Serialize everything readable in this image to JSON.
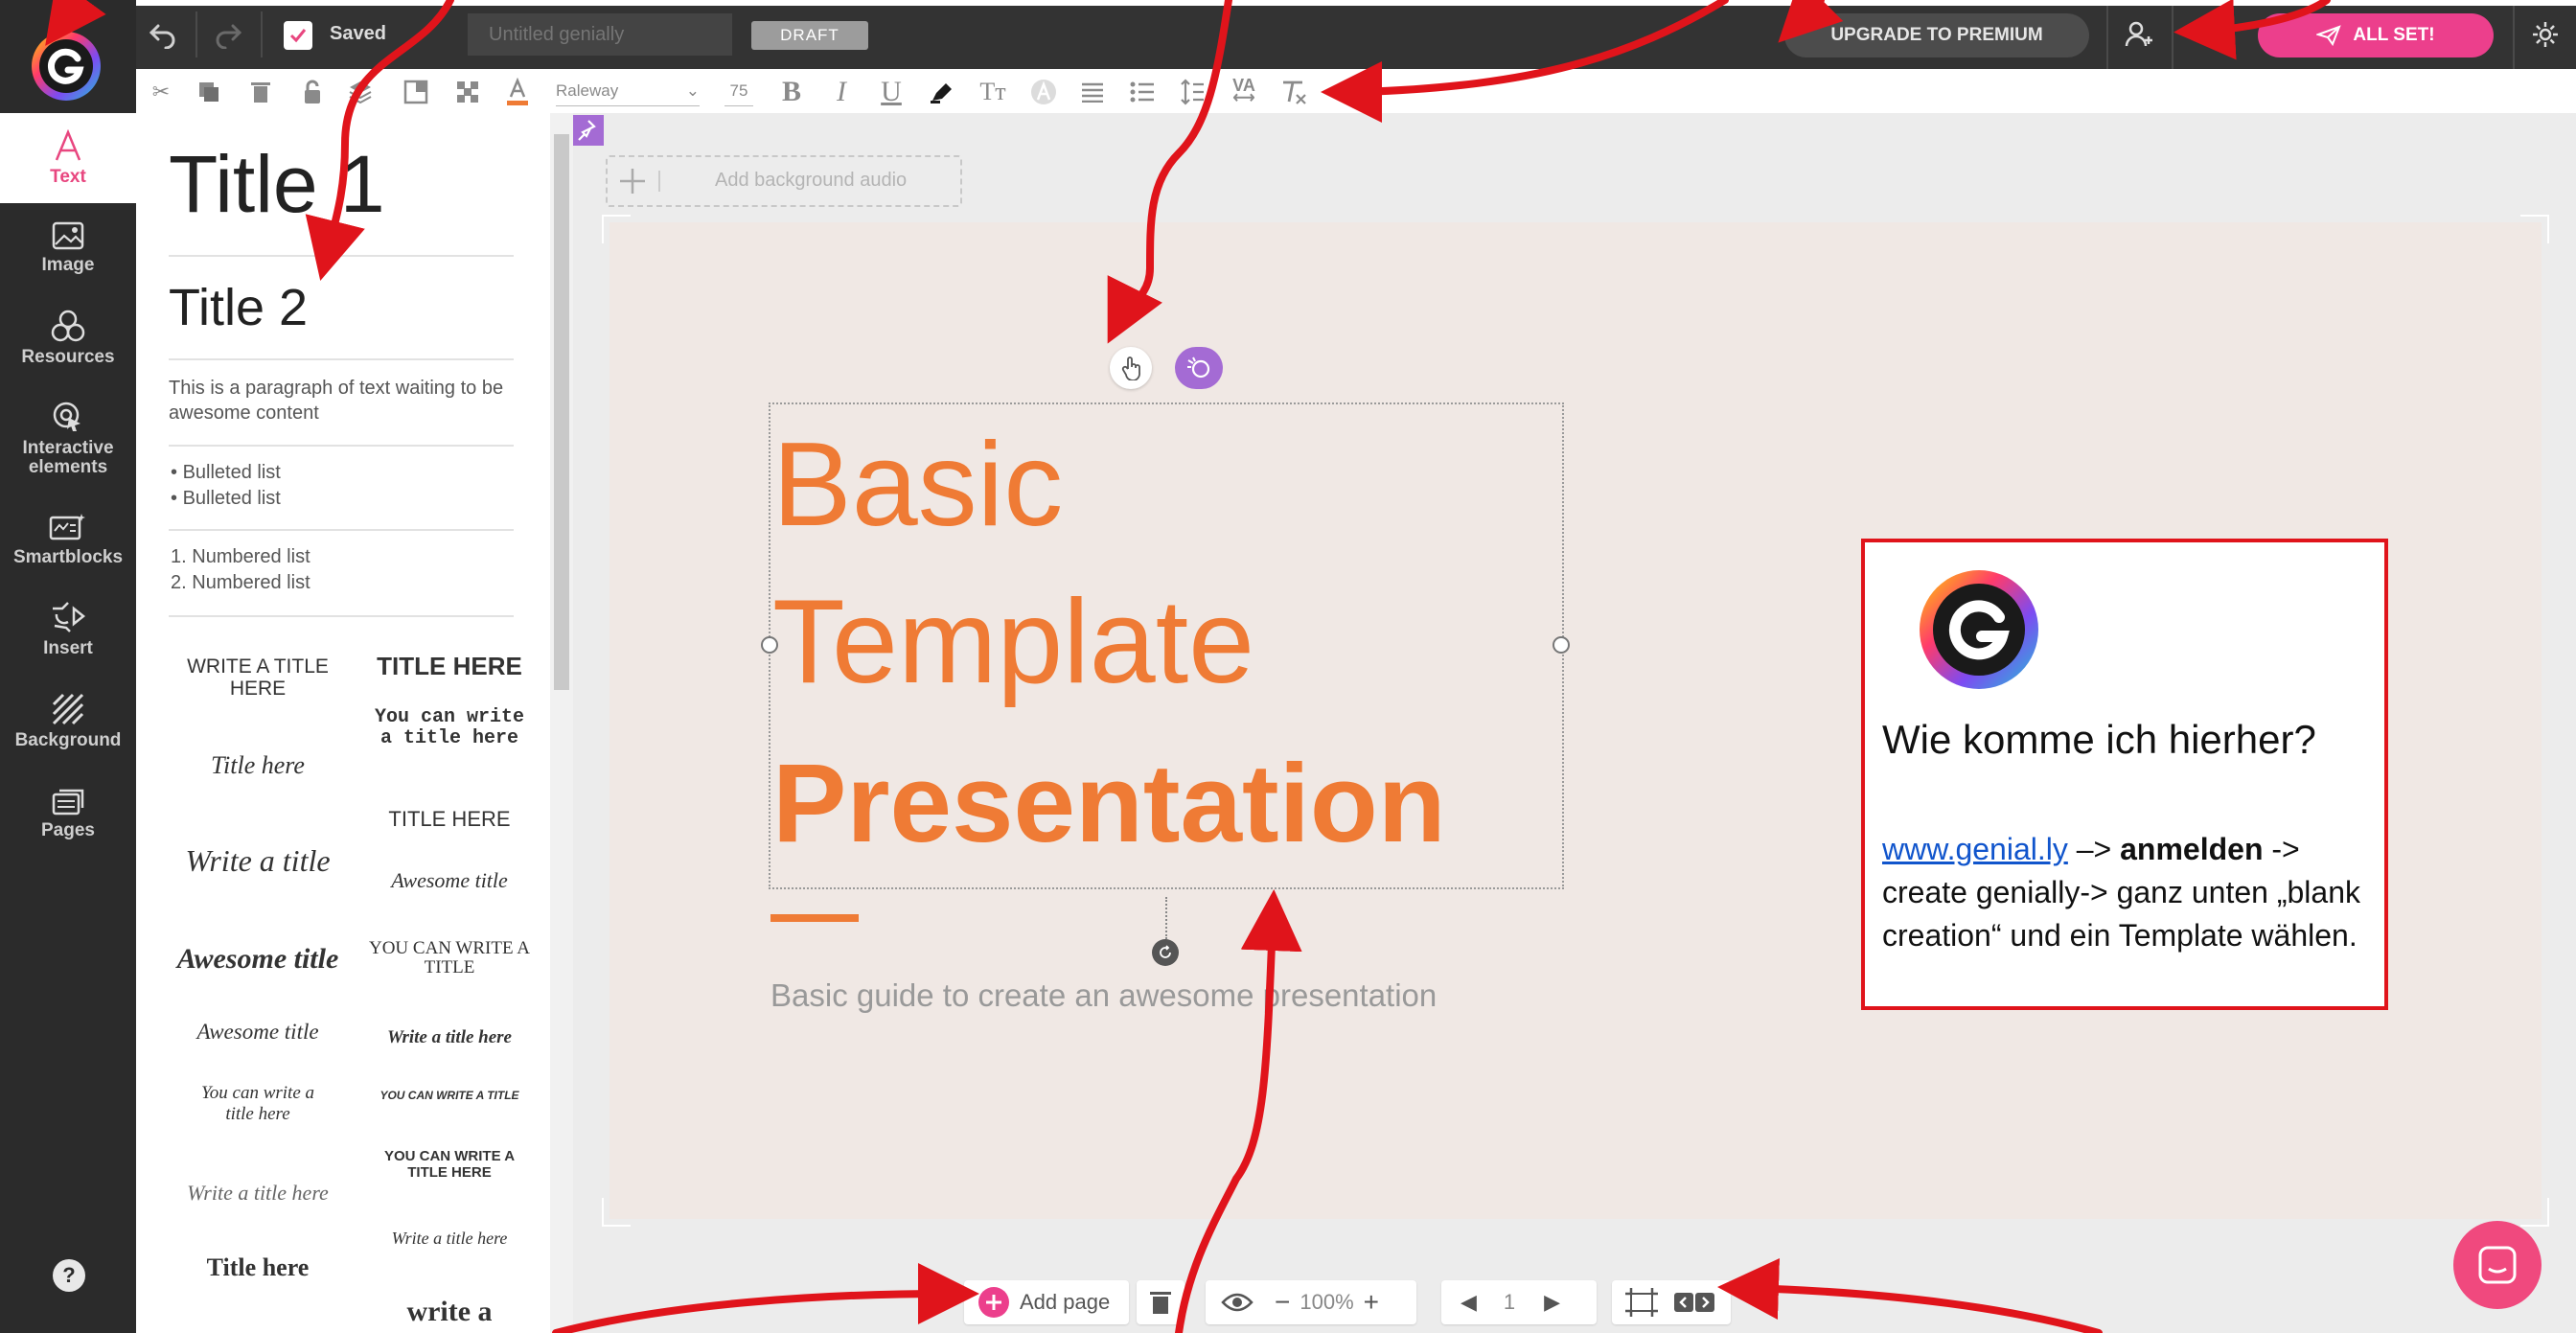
{
  "topbar": {
    "saved_label": "Saved",
    "title_placeholder": "Untitled genially",
    "draft_badge": "DRAFT",
    "upgrade_label": "UPGRADE TO PREMIUM",
    "allset_label": "ALL SET!"
  },
  "format_toolbar": {
    "font_name": "Raleway",
    "font_size": "75"
  },
  "sidebar": {
    "items": [
      {
        "label": "Text",
        "active": true
      },
      {
        "label": "Image"
      },
      {
        "label": "Resources"
      },
      {
        "label": "Interactive elements"
      },
      {
        "label": "Smartblocks"
      },
      {
        "label": "Insert"
      },
      {
        "label": "Background"
      },
      {
        "label": "Pages"
      }
    ],
    "help": "?"
  },
  "text_panel": {
    "title1": "Title 1",
    "title2": "Title 2",
    "paragraph": "This is a paragraph of text waiting to be awesome content",
    "bullets": [
      "Bulleted list",
      "Bulleted list"
    ],
    "numbered": [
      "Numbered list",
      "Numbered list"
    ],
    "templates": [
      {
        "main": "WRITE A TITLE HERE"
      },
      {
        "main": "TITLE HERE"
      },
      {
        "main": "You can write a title here"
      },
      {
        "main": "Title here"
      },
      {
        "main": "TITLE HERE"
      },
      {
        "main": "Write a title"
      },
      {
        "main": "Awesome title"
      },
      {
        "main": "Awesome title"
      },
      {
        "main": "YOU CAN WRITE A TITLE"
      },
      {
        "main": "Awesome title"
      },
      {
        "main": "Write a title here"
      },
      {
        "main": "You can write a title here"
      },
      {
        "main": "YOU CAN WRITE A TITLE"
      },
      {
        "main": "YOU CAN WRITE A TITLE HERE"
      },
      {
        "main": "Write a title here"
      },
      {
        "main": "Write a title here"
      },
      {
        "main": "Title here"
      },
      {
        "main": "write a"
      }
    ]
  },
  "canvas": {
    "audio_label": "Add background audio",
    "slide_line1": "Basic",
    "slide_line2": "Template",
    "slide_line3": "Presentation",
    "slide_subtitle": "Basic guide to create an awesome presentation",
    "accent_color": "#ef7b35"
  },
  "info_box": {
    "question": "Wie komme ich hierher?",
    "link": "www.genial.ly",
    "arrow1": " –> ",
    "bold1": "anmelden",
    "rest": " -> create genially-> ganz unten „blank creation“ und ein Template wählen."
  },
  "bottom_bar": {
    "add_page": "Add page",
    "zoom": "100%",
    "page_number": "1"
  },
  "colors": {
    "brand_pink": "#ec3f8c",
    "annotation_red": "#e0141b"
  }
}
